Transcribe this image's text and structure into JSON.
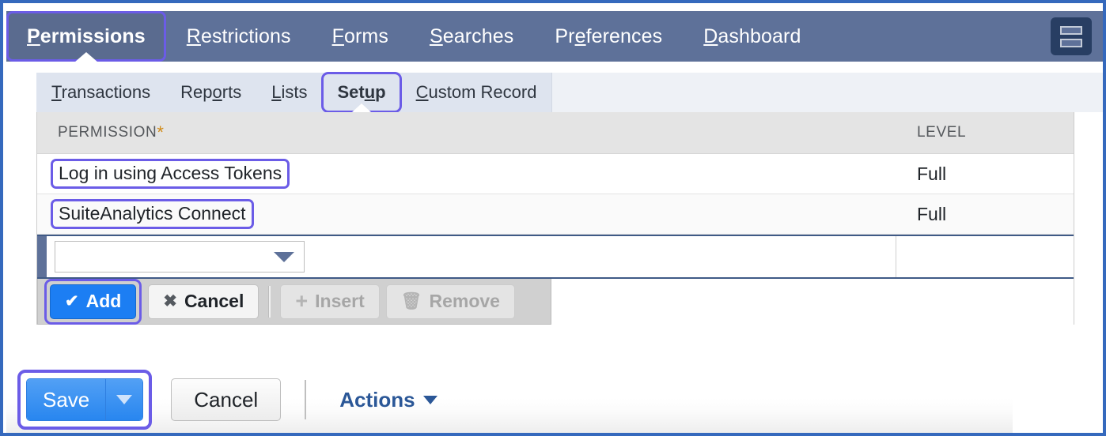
{
  "primary_nav": {
    "tabs": [
      {
        "label": "Permissions",
        "accesskey": "P",
        "active": true
      },
      {
        "label": "Restrictions",
        "accesskey": "R",
        "active": false
      },
      {
        "label": "Forms",
        "accesskey": "F",
        "active": false
      },
      {
        "label": "Searches",
        "accesskey": "S",
        "active": false
      },
      {
        "label": "Preferences",
        "accesskey": "e",
        "active": false
      },
      {
        "label": "Dashboard",
        "accesskey": "D",
        "active": false
      }
    ],
    "layout_button_name": "split-layout-icon"
  },
  "sub_nav": {
    "tabs": [
      {
        "label": "Transactions",
        "accesskey": "T",
        "active": false
      },
      {
        "label": "Reports",
        "accesskey": "o",
        "active": false
      },
      {
        "label": "Lists",
        "accesskey": "L",
        "active": false
      },
      {
        "label": "Setup",
        "accesskey": "u",
        "active": true
      },
      {
        "label": "Custom Record",
        "accesskey": "C",
        "active": false
      }
    ]
  },
  "grid": {
    "columns": {
      "permission": "PERMISSION",
      "permission_required_marker": "*",
      "level": "LEVEL"
    },
    "rows": [
      {
        "permission": "Log in using Access Tokens",
        "level": "Full",
        "highlighted": true
      },
      {
        "permission": "SuiteAnalytics Connect",
        "level": "Full",
        "highlighted": true
      }
    ],
    "edit_row": {
      "permission_value": "",
      "permission_placeholder": "",
      "level_value": "",
      "dropdown_icon": "chevron-down-icon"
    },
    "row_buttons": [
      {
        "label": "Add",
        "icon": "check-icon",
        "style": "primary",
        "disabled": false,
        "highlighted": true
      },
      {
        "label": "Cancel",
        "icon": "x-icon",
        "style": "plain",
        "disabled": false,
        "highlighted": false
      },
      {
        "label": "Insert",
        "icon": "plus-icon",
        "style": "disabled",
        "disabled": true,
        "highlighted": false
      },
      {
        "label": "Remove",
        "icon": "trash-icon",
        "style": "disabled",
        "disabled": true,
        "highlighted": false
      }
    ]
  },
  "footer": {
    "save_label": "Save",
    "save_dropdown_icon": "caret-down-icon",
    "cancel_label": "Cancel",
    "actions_label": "Actions",
    "actions_caret_icon": "caret-down-icon"
  },
  "colors": {
    "nav_background": "#5e7199",
    "subnav_background": "#dee4ef",
    "highlight_outline": "#6b5ce7",
    "primary_button": "#1c7ef3",
    "link": "#2b5797",
    "required_star": "#d08a16",
    "page_border": "#3569bd"
  }
}
